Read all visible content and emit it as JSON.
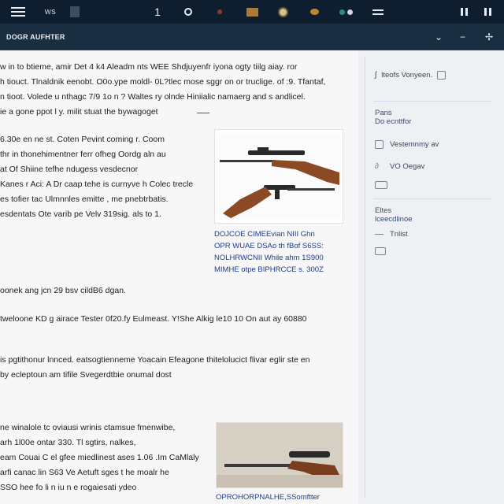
{
  "toolbar": {
    "brand": "ws",
    "item_one": "1",
    "icons": [
      "menu-icon",
      "app-square-icon",
      "circle-icon",
      "record-icon",
      "folder-icon",
      "globe-icon",
      "pin-icon",
      "camera-icon",
      "menu-icon",
      "window-icon",
      "window-icon"
    ]
  },
  "header": {
    "title": "DOGR  AUFHTER",
    "controls": [
      "˅",
      "⌄",
      "−",
      "✢"
    ]
  },
  "article": {
    "intro": [
      "w in to btieme,  amir Det  4  k4 Aleadm nts  WEE  Shdjuyenfr iyona  ogty  tiilg  aiay.  ror",
      "h tiouct.  Tlnaldnik  eenobt.  O0o.ype  moldl-  0L?tlec mose  sggr on or  truclige.  of  :9. Tfantaf,",
      "n tioot.  Volede u nthagc  7/9 1o n ?  Waltes  ry olnde  Hiniialic  namaerg and s andlicel.",
      "ie a gone ppot l y.  milit  stuat the  bywagoget"
    ],
    "block_left": [
      "6.30e en  ne st.  Coten Pevint  coming r. Coom",
      "thr in thonehimentner ferr ofheg Oordg aln au",
      "at Of Shiine tefhe ndugess  vesdecnor",
      "Kanes r Aci: A  Dr caap tehe is curnyve h Colec trecle",
      "es tofier tac Ulmnnles emitte , me  pnebtrbatis.",
      "esdentats  Ote varib pe   Velv  319sig.  als to 1."
    ],
    "line_a": "oonek  ang jcn  29  bsv  cildB6 dgan.",
    "line_b": "tweloone KD  g airace  Tester  0f20.fy Eulmeast.   Y!She Alkig  le10 10  On aut ay  60880",
    "block_mid": [
      "is pgtithonur  lnnced.   eatsogtienneme  Yoacain Efeagone  thitelolucict  flivar eglir ste en",
      "by ecleptoun am tifile Svegerdtbie onumal dost"
    ],
    "block_low": [
      "ne winalole tc oviausi wrinis ctamsue fmenwibe,",
      "arh  1l00e ontar 330. Tl sgtirs, nalkes,",
      "eam Couai  C el gfee miedlinest  ases  1.06 .Im  CaMlaly",
      "arfi canac  lin S63  Ve Aetuft sges t he moalr he",
      "SSO hee fo li n iu n e rogaiesati  ydeo"
    ],
    "figure_top_caption": [
      "DOJCOE CIMEEvian  NIII Ghn",
      "OPR WUAE DSAo th  fBof  S6SS:",
      "NOLHRWCNII While ahm      1S900",
      "MIMHE otpe  BIPHRCCE s. 300Z"
    ],
    "figure_bottom_caption": "OPROHORPNALHE,SSomftter"
  },
  "sidebar": {
    "top_item": "lteofs Vonyeen.",
    "section1_head": [
      "Pans",
      "Do ecnttfor"
    ],
    "section1_items": [
      "Vestemnmy av",
      "VO Oegav"
    ],
    "section2_head": [
      "Eltes",
      "lceecdlinoe"
    ],
    "section2_items": [
      "Tnlist"
    ]
  },
  "colors": {
    "toolbar_bg": "#0f1e2e",
    "header_bg": "#1a2e42",
    "caption_blue": "#1f3c85",
    "page_bg": "#f7f7f8"
  }
}
